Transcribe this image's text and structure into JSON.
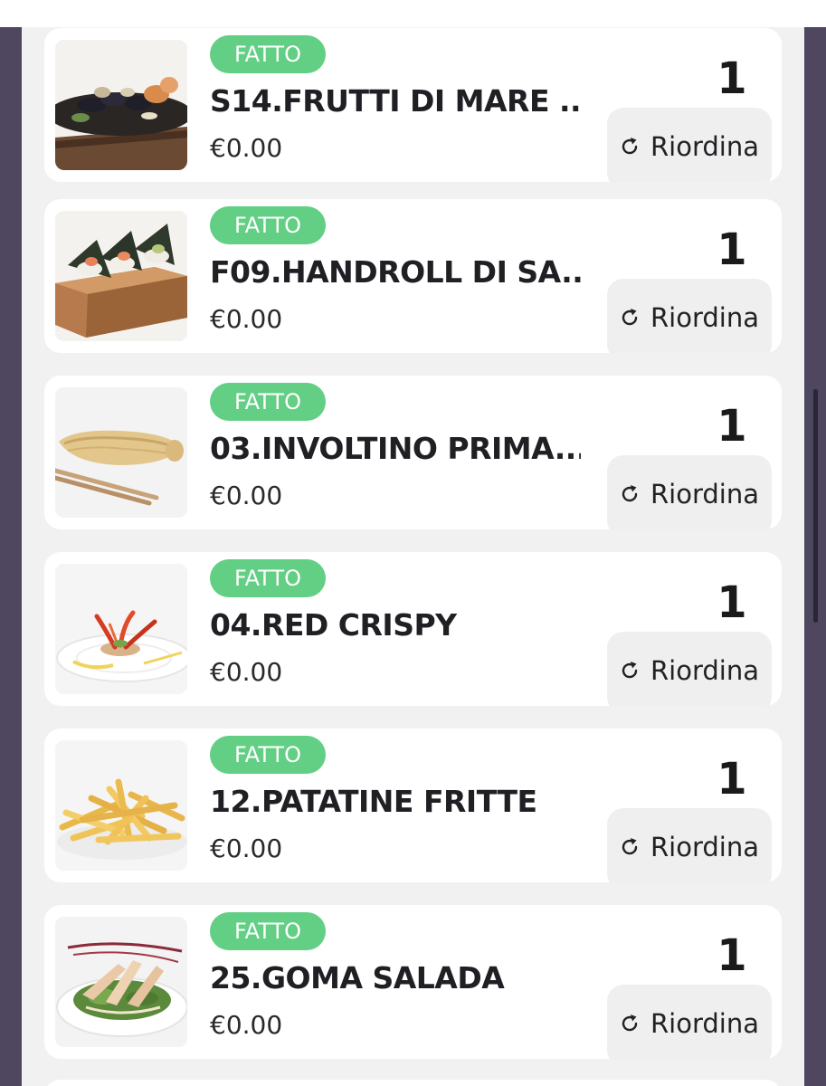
{
  "orders": [
    {
      "status": "FATTO",
      "name": "S14.FRUTTI DI MARE ...",
      "price": "€0.00",
      "qty": "1",
      "reorder_label": "Riordina",
      "image": "seafood-platter"
    },
    {
      "status": "FATTO",
      "name": "F09.HANDROLL DI SA...",
      "price": "€0.00",
      "qty": "1",
      "reorder_label": "Riordina",
      "image": "handroll-board"
    },
    {
      "status": "FATTO",
      "name": "03.INVOLTINO PRIMA...",
      "price": "€0.00",
      "qty": "1",
      "reorder_label": "Riordina",
      "image": "spring-roll"
    },
    {
      "status": "FATTO",
      "name": "04.RED CRISPY",
      "price": "€0.00",
      "qty": "1",
      "reorder_label": "Riordina",
      "image": "red-crispy-plate"
    },
    {
      "status": "FATTO",
      "name": "12.PATATINE FRITTE",
      "price": "€0.00",
      "qty": "1",
      "reorder_label": "Riordina",
      "image": "french-fries"
    },
    {
      "status": "FATTO",
      "name": "25.GOMA SALADA",
      "price": "€0.00",
      "qty": "1",
      "reorder_label": "Riordina",
      "image": "goma-salad"
    }
  ],
  "icons": {
    "reorder": "refresh-icon"
  },
  "colors": {
    "status_badge": "#62cf85",
    "frame": "#4f4760",
    "panel_background": "#f1f1f1",
    "card_background": "#ffffff",
    "reorder_button": "#efefef"
  }
}
